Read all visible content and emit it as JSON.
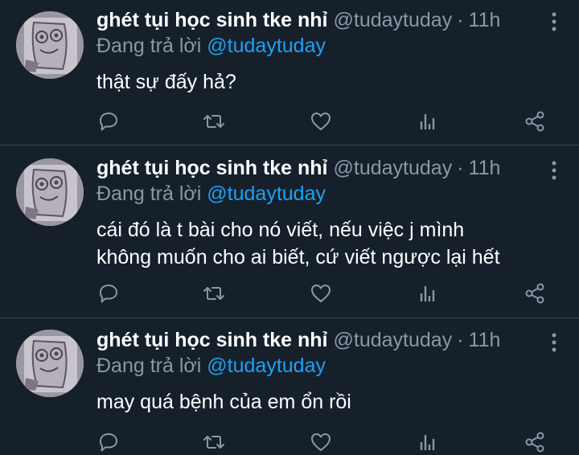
{
  "tweets": [
    {
      "display_name": "ghét tụi học sinh tke nhỉ",
      "handle": "@tudaytuday",
      "separator": "·",
      "time": "11h",
      "reply_prefix": "Đang trả lời",
      "reply_to": "@tudaytuday",
      "text": "thật sự đấy hả?"
    },
    {
      "display_name": "ghét tụi học sinh tke nhỉ",
      "handle": "@tudaytuday",
      "separator": "·",
      "time": "11h",
      "reply_prefix": "Đang trả lời",
      "reply_to": "@tudaytuday",
      "text": "cái đó là t bài cho nó viết, nếu việc j mình\nkhông muốn cho ai biết, cứ viết ngược lại hết"
    },
    {
      "display_name": "ghét tụi học sinh tke nhỉ",
      "handle": "@tudaytuday",
      "separator": "·",
      "time": "11h",
      "reply_prefix": "Đang trả lời",
      "reply_to": "@tudaytuday",
      "text": "may quá bệnh của em ổn rồi"
    }
  ],
  "icons": {
    "reply": "reply-icon",
    "retweet": "retweet-icon",
    "like": "heart-icon",
    "analytics": "analytics-icon",
    "share": "share-icon",
    "more": "more-vertical-icon"
  },
  "colors": {
    "background": "#15202b",
    "divider": "#38444d",
    "primary_text": "#ffffff",
    "secondary_text": "#8899a6",
    "link": "#1da1f2"
  }
}
